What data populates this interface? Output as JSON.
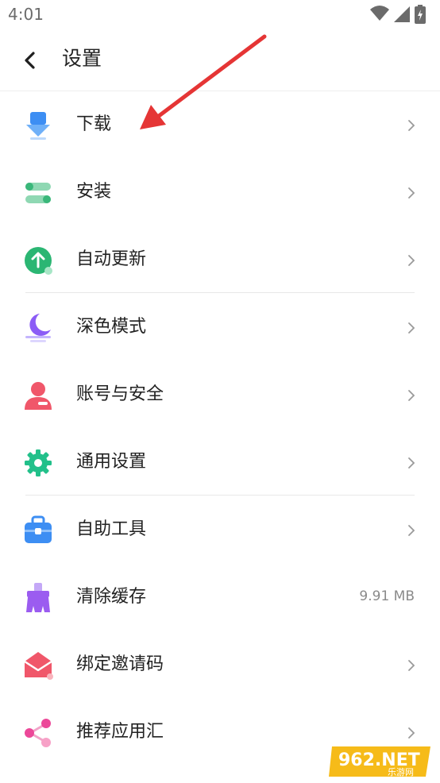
{
  "status_bar": {
    "time": "4:01"
  },
  "app_bar": {
    "title": "设置"
  },
  "settings_items": [
    {
      "label": "下载",
      "icon": "download-icon",
      "color": "#3d8ef3"
    },
    {
      "label": "安装",
      "icon": "install-icon",
      "color": "#3ab77a"
    },
    {
      "label": "自动更新",
      "icon": "auto-update-icon",
      "color": "#2bb673"
    },
    {
      "label": "深色模式",
      "icon": "dark-mode-icon",
      "color": "#8b5cf6"
    },
    {
      "label": "账号与安全",
      "icon": "account-security-icon",
      "color": "#f0576a"
    },
    {
      "label": "通用设置",
      "icon": "gear-icon",
      "color": "#22c08a"
    },
    {
      "label": "自助工具",
      "icon": "toolbox-icon",
      "color": "#3d8ef3"
    },
    {
      "label": "清除缓存",
      "icon": "clear-cache-icon",
      "color": "#9b5cf0",
      "value": "9.91 MB"
    },
    {
      "label": "绑定邀请码",
      "icon": "envelope-icon",
      "color": "#f0576a"
    },
    {
      "label": "推荐应用汇",
      "icon": "share-icon",
      "color": "#ec4899"
    }
  ],
  "watermark": {
    "text": "962.NET",
    "subtext": "乐游网"
  }
}
